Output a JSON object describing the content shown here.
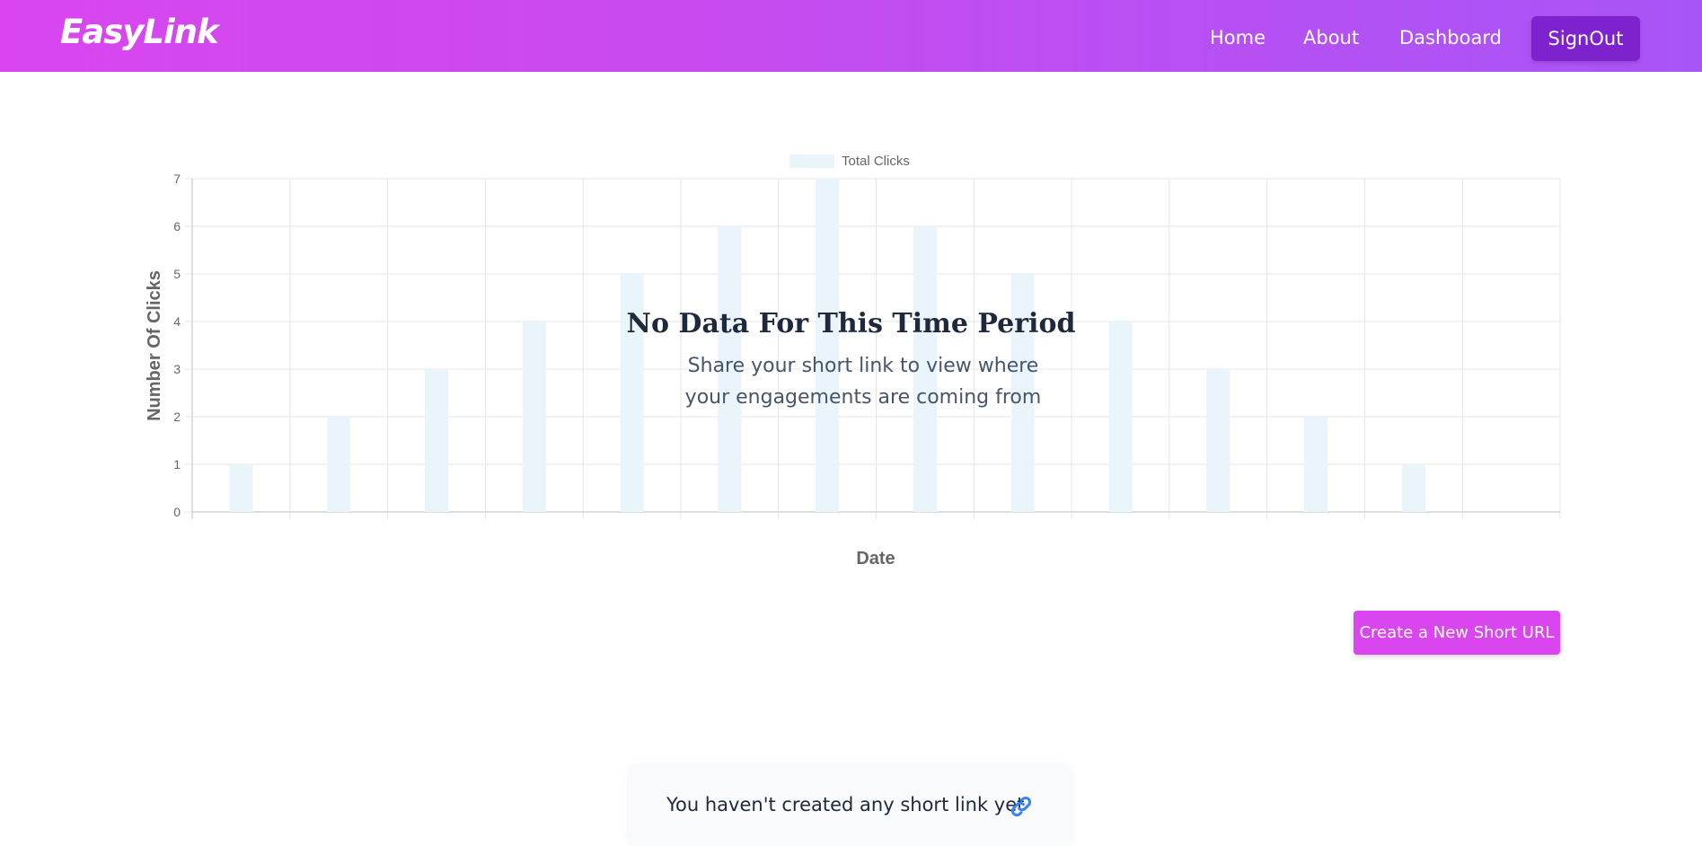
{
  "navbar": {
    "brand": "EasyLink",
    "links": [
      "Home",
      "About",
      "Dashboard"
    ],
    "signout_label": "SignOut"
  },
  "chart_overlay": {
    "title": "No Data For This Time Period",
    "subtitle": "Share your short link to view where your engagements are coming from"
  },
  "actions": {
    "create_label": "Create a New Short URL"
  },
  "empty_state": {
    "message": "You haven't created any short link yet",
    "icon": "link-icon"
  },
  "colors": {
    "nav_gradient_start": "#d946ef",
    "nav_gradient_end": "#a855f7",
    "signout_bg": "#7e22ce",
    "create_bg": "#d946ef",
    "bar_color": "#e9f4fb"
  },
  "chart_data": {
    "type": "bar",
    "legend": {
      "label": "Total Clicks",
      "position": "top"
    },
    "xlabel": "Date",
    "ylabel": "Number Of Clicks",
    "ylim": [
      0,
      7
    ],
    "yticks": [
      0,
      1,
      2,
      3,
      4,
      5,
      6,
      7
    ],
    "grid": true,
    "categories": [
      "",
      "",
      "",
      "",
      "",
      "",
      "",
      "",
      "",
      "",
      "",
      "",
      "",
      ""
    ],
    "series": [
      {
        "name": "Total Clicks",
        "values": [
          1,
          2,
          3,
          4,
          5,
          6,
          7,
          6,
          5,
          4,
          3,
          2,
          1,
          0
        ]
      }
    ]
  }
}
